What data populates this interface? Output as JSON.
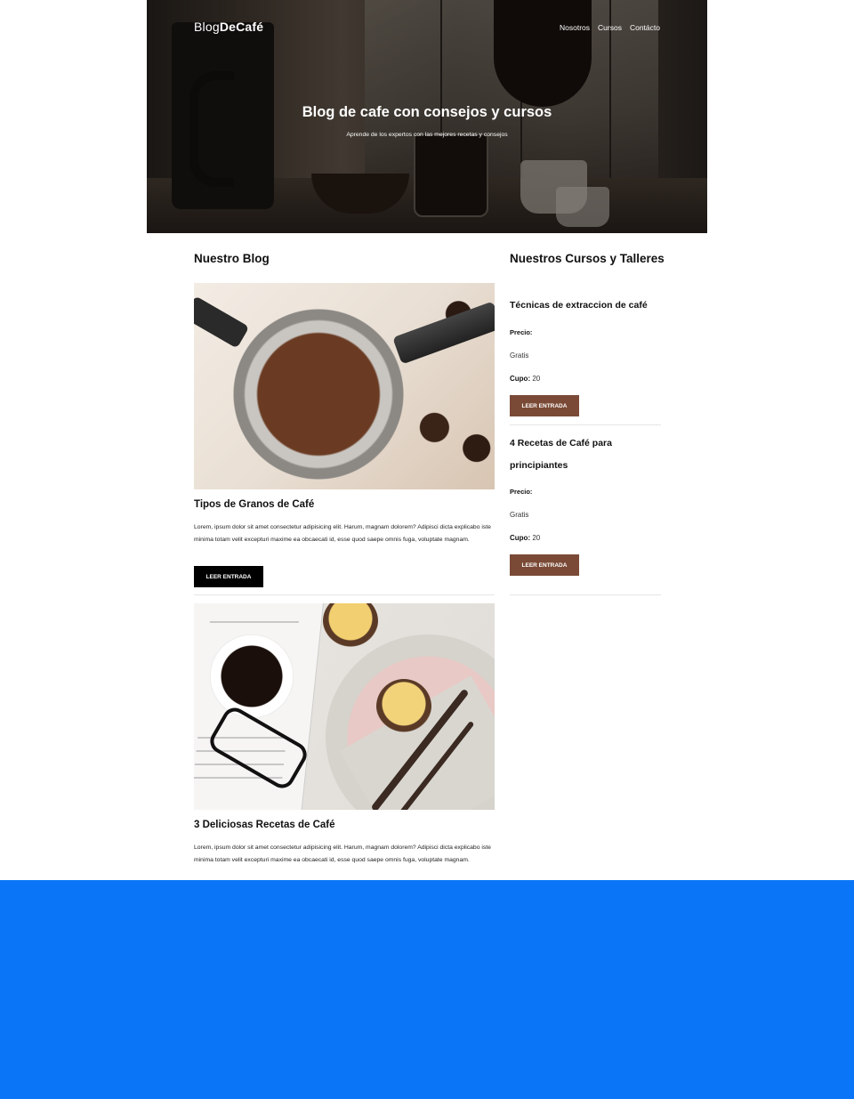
{
  "header": {
    "logo_prefix": "Blog",
    "logo_bold": "DeCafé",
    "nav": [
      "Nosotros",
      "Cursos",
      "Contácto"
    ],
    "title": "Blog de cafe con consejos y cursos",
    "subtitle": "Aprende de los expertos con las mejores recetas y consejos"
  },
  "blog": {
    "section_title": "Nuestro Blog",
    "posts": [
      {
        "title": "Tipos de Granos de Café",
        "text": "Lorem, ipsum dolor sit amet consectetur adipisicing elit. Harum, magnam dolorem? Adipisci dicta explicabo iste minima totam velit excepturi maxime ea obcaecati id, esse quod saepe omnis fuga, voluptate magnam.",
        "button": "LEER ENTRADA"
      },
      {
        "title": "3 Deliciosas Recetas de Café",
        "text": "Lorem, ipsum dolor sit amet consectetur adipisicing elit. Harum, magnam dolorem? Adipisci dicta explicabo iste minima totam velit excepturi maxime ea obcaecati id, esse quod saepe omnis fuga, voluptate magnam."
      }
    ]
  },
  "courses": {
    "section_title": "Nuestros Cursos y Talleres",
    "items": [
      {
        "title": "Técnicas de extraccion de café",
        "price_label": "Precio:",
        "price": "Gratis",
        "cupo_label": "Cupo:",
        "cupo": "20",
        "button": "LEER ENTRADA"
      },
      {
        "title": "4 Recetas de Café para principiantes",
        "price_label": "Precio:",
        "price": "Gratis",
        "cupo_label": "Cupo:",
        "cupo": "20",
        "button": "LEER ENTRADA"
      }
    ]
  },
  "colors": {
    "brown_button": "#7a4a36",
    "background_blue": "#0a76f7"
  }
}
